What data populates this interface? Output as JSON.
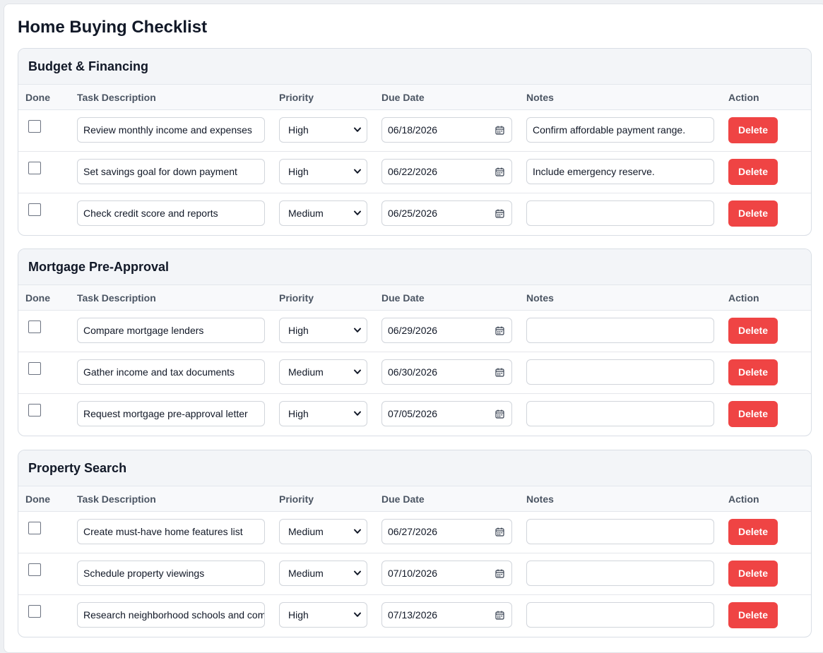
{
  "title": "Home Buying Checklist",
  "columns": {
    "done": "Done",
    "task": "Task Description",
    "priority": "Priority",
    "due": "Due Date",
    "notes": "Notes",
    "action": "Action"
  },
  "delete_label": "Delete",
  "colors": {
    "delete": "#ef4444",
    "header_bg": "#f3f5f8"
  },
  "sections": [
    {
      "title": "Budget & Financing",
      "rows": [
        {
          "done": false,
          "task": "Review monthly income and expenses",
          "priority": "High",
          "due": "06/18/2026",
          "notes": "Confirm affordable payment range."
        },
        {
          "done": false,
          "task": "Set savings goal for down payment",
          "priority": "High",
          "due": "06/22/2026",
          "notes": "Include emergency reserve."
        },
        {
          "done": false,
          "task": "Check credit score and reports",
          "priority": "Medium",
          "due": "06/25/2026",
          "notes": ""
        }
      ]
    },
    {
      "title": "Mortgage Pre-Approval",
      "rows": [
        {
          "done": false,
          "task": "Compare mortgage lenders",
          "priority": "High",
          "due": "06/29/2026",
          "notes": ""
        },
        {
          "done": false,
          "task": "Gather income and tax documents",
          "priority": "Medium",
          "due": "06/30/2026",
          "notes": ""
        },
        {
          "done": false,
          "task": "Request mortgage pre-approval letter",
          "priority": "High",
          "due": "07/05/2026",
          "notes": ""
        }
      ]
    },
    {
      "title": "Property Search",
      "rows": [
        {
          "done": false,
          "task": "Create must-have home features list",
          "priority": "Medium",
          "due": "06/27/2026",
          "notes": ""
        },
        {
          "done": false,
          "task": "Schedule property viewings",
          "priority": "Medium",
          "due": "07/10/2026",
          "notes": ""
        },
        {
          "done": false,
          "task": "Research neighborhood schools and comm",
          "priority": "High",
          "due": "07/13/2026",
          "notes": ""
        }
      ]
    }
  ]
}
